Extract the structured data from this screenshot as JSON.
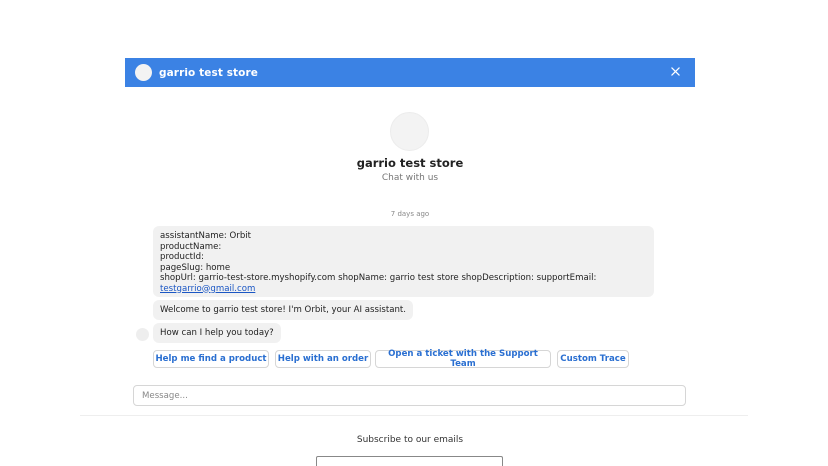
{
  "colors": {
    "accent": "#3b82e4",
    "quick_reply_text": "#2a6fd1"
  },
  "header": {
    "title": "garrio test store",
    "close_icon": "close-icon"
  },
  "hero": {
    "title": "garrio test store",
    "subtitle": "Chat with us"
  },
  "messages": {
    "timestamp": "7 days ago",
    "meta": {
      "line1": "assistantName: Orbit",
      "line2": "productName:",
      "line3": "productId:",
      "line4": "pageSlug: home",
      "line5": "shopUrl: garrio-test-store.myshopify.com shopName: garrio test store shopDescription:  supportEmail:",
      "email": "testgarrio@gmail.com"
    },
    "welcome": "Welcome to garrio test store!  I'm Orbit, your AI assistant.",
    "help": "How can I help you today?"
  },
  "quick_replies": [
    "Help me find a product",
    "Help with an order",
    "Open a ticket with the Support Team",
    "Custom Trace"
  ],
  "composer": {
    "placeholder": "Message..."
  },
  "footer": {
    "subscribe_label": "Subscribe to our emails"
  }
}
